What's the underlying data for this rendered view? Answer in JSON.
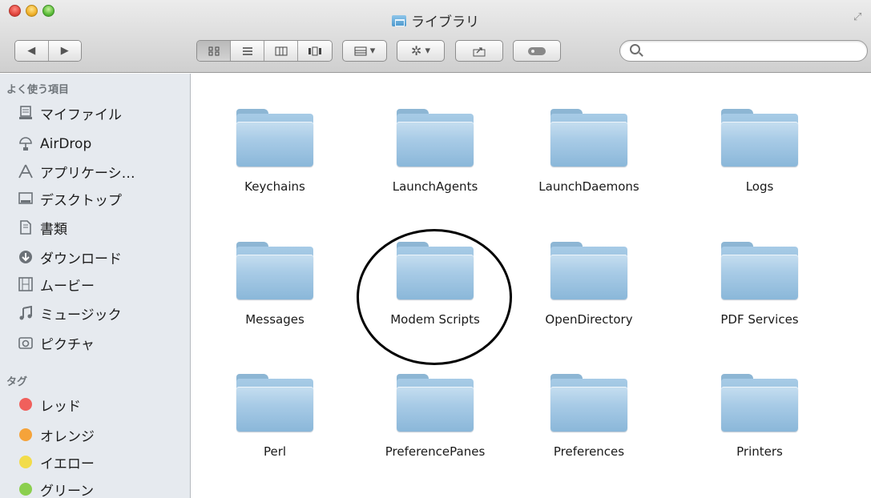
{
  "window": {
    "title": "ライブラリ"
  },
  "toolbar": {
    "back_glyph": "◀",
    "forward_glyph": "▶",
    "view_icons": [
      "icon-view",
      "list-view",
      "column-view",
      "coverflow-view"
    ],
    "arrange_glyph": "▾",
    "action_glyph": "▾",
    "search_placeholder": ""
  },
  "sidebar": {
    "favorites_heading": "よく使う項目",
    "favorites": [
      {
        "label": "マイファイル",
        "icon": "all-my-files-icon"
      },
      {
        "label": "AirDrop",
        "icon": "airdrop-icon"
      },
      {
        "label": "アプリケーシ…",
        "icon": "applications-icon"
      },
      {
        "label": "デスクトップ",
        "icon": "desktop-icon"
      },
      {
        "label": "書類",
        "icon": "documents-icon"
      },
      {
        "label": "ダウンロード",
        "icon": "downloads-icon"
      },
      {
        "label": "ムービー",
        "icon": "movies-icon"
      },
      {
        "label": "ミュージック",
        "icon": "music-icon"
      },
      {
        "label": "ピクチャ",
        "icon": "pictures-icon"
      }
    ],
    "tags_heading": "タグ",
    "tags": [
      {
        "label": "レッド",
        "color": "#f0605c"
      },
      {
        "label": "オレンジ",
        "color": "#f5a33a"
      },
      {
        "label": "イエロー",
        "color": "#f2dc4a"
      },
      {
        "label": "グリーン",
        "color": "#8bcf4e"
      }
    ]
  },
  "folders": [
    {
      "label": "Keychains"
    },
    {
      "label": "LaunchAgents"
    },
    {
      "label": "LaunchDaemons"
    },
    {
      "label": "Logs"
    },
    {
      "label": "Messages"
    },
    {
      "label": "Modem Scripts",
      "highlighted": true
    },
    {
      "label": "OpenDirectory"
    },
    {
      "label": "PDF Services"
    },
    {
      "label": "Perl"
    },
    {
      "label": "PreferencePanes"
    },
    {
      "label": "Preferences"
    },
    {
      "label": "Printers"
    }
  ]
}
